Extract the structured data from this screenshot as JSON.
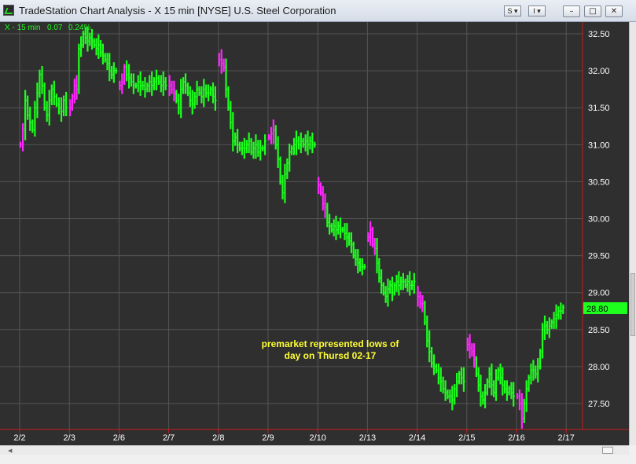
{
  "window": {
    "title": "TradeStation Chart Analysis - X 15 min [NYSE] U.S. Steel Corporation",
    "btn_s": "S",
    "btn_i": "I",
    "minimize_glyph": "–",
    "maximize_glyph": "□",
    "close_glyph": "✕"
  },
  "chart_data": {
    "type": "line",
    "title": "",
    "symbol_label": "X - 15 min",
    "change": "0.07",
    "change_pct": "0.24%",
    "last_price": "28.80",
    "xlabel": "",
    "ylabel": "",
    "ylim": [
      27.2,
      32.58
    ],
    "y_ticks": [
      "32.50",
      "32.00",
      "31.50",
      "31.00",
      "30.50",
      "30.00",
      "29.50",
      "29.00",
      "28.50",
      "28.00",
      "27.50"
    ],
    "x_ticks": [
      "2/2",
      "2/3",
      "2/6",
      "2/7",
      "2/8",
      "2/9",
      "2/10",
      "2/13",
      "2/14",
      "2/15",
      "2/16",
      "2/17"
    ],
    "grid": true,
    "annotation": [
      "premarket represented lows of",
      "day on Thursd 02-17"
    ],
    "colors": {
      "up": "#1eff1e",
      "premarket": "#ff28ff",
      "background": "#2f2f2f",
      "grid": "#555555",
      "axis": "#c81e1e",
      "annotation": "#ffff33",
      "tick_text": "#ffffff",
      "last_price_bg": "#1eff1e"
    },
    "series": [
      {
        "name": "X - 15 min",
        "days": [
          {
            "date": "2/2",
            "pre": [
              31.0,
              31.2
            ],
            "regular": [
              31.6,
              31.4,
              31.3,
              31.2,
              31.5,
              31.7,
              31.95,
              31.8,
              31.5,
              31.4,
              31.6,
              31.75,
              31.65,
              31.55,
              31.5,
              31.45,
              31.6,
              31.5
            ]
          },
          {
            "date": "2/3",
            "pre": [
              31.5,
              31.65,
              31.8,
              31.75
            ],
            "regular": [
              32.3,
              32.35,
              32.5,
              32.45,
              32.4,
              32.45,
              32.4,
              32.35,
              32.3,
              32.35,
              32.25,
              32.2,
              32.15,
              32.1,
              32.0,
              31.95,
              32.0,
              32.0
            ]
          },
          {
            "date": "2/6",
            "pre": [
              31.8,
              31.85,
              32.05
            ],
            "regular": [
              31.95,
              31.9,
              31.85,
              31.8,
              31.8,
              31.85,
              31.8,
              31.8,
              31.75,
              31.8,
              31.85,
              31.8,
              31.85,
              31.9,
              31.85,
              31.8,
              31.85,
              31.8
            ]
          },
          {
            "date": "2/7",
            "pre": [
              31.8,
              31.75,
              31.7
            ],
            "regular": [
              31.6,
              31.5,
              31.75,
              31.85,
              31.8,
              31.7,
              31.6,
              31.55,
              31.65,
              31.75,
              31.7,
              31.65,
              31.75,
              31.7,
              31.7,
              31.75,
              31.65,
              31.6
            ]
          },
          {
            "date": "2/8",
            "pre": [
              32.15,
              32.1,
              32.05
            ],
            "regular": [
              31.75,
              31.5,
              31.3,
              31.05,
              31.1,
              31.0,
              30.95,
              30.95,
              30.95,
              31.0,
              31.05,
              30.9,
              30.95,
              31.0,
              30.9,
              30.95,
              30.95,
              31.05
            ]
          },
          {
            "date": "2/9",
            "pre": [
              31.1,
              31.15,
              31.2
            ],
            "regular": [
              31.0,
              30.8,
              30.5,
              30.35,
              30.6,
              30.75,
              30.9,
              30.95,
              31.0,
              31.05,
              31.0,
              31.05,
              31.0,
              31.05,
              31.0,
              31.05,
              31.0,
              31.0
            ]
          },
          {
            "date": "2/10",
            "pre": [
              30.45,
              30.35,
              30.2,
              30.15
            ],
            "regular": [
              29.95,
              29.9,
              29.85,
              29.9,
              29.85,
              29.9,
              29.85,
              29.85,
              29.8,
              29.75,
              29.7,
              29.65,
              29.5,
              29.45,
              29.4,
              29.35,
              29.35,
              29.35
            ]
          },
          {
            "date": "2/13",
            "pre": [
              29.75,
              29.85,
              29.65,
              29.6
            ],
            "regular": [
              29.4,
              29.2,
              29.1,
              29.0,
              28.95,
              29.05,
              29.1,
              29.0,
              29.1,
              29.15,
              29.1,
              29.15,
              29.15,
              29.1,
              29.15,
              29.1,
              29.1,
              29.15
            ]
          },
          {
            "date": "2/14",
            "pre": [
              28.95,
              28.85,
              28.85
            ],
            "regular": [
              28.6,
              28.35,
              28.2,
              28.05,
              28.0,
              27.95,
              27.85,
              27.8,
              27.7,
              27.65,
              27.6,
              27.6,
              27.55,
              27.7,
              27.8,
              27.9,
              27.85,
              27.8
            ]
          },
          {
            "date": "2/15",
            "pre": [
              28.3,
              28.25,
              28.2,
              28.1
            ],
            "regular": [
              27.9,
              27.75,
              27.6,
              27.55,
              27.65,
              27.8,
              27.9,
              27.75,
              27.65,
              27.85,
              27.95,
              27.85,
              27.75,
              27.7,
              27.65,
              27.7,
              27.65,
              27.6
            ]
          },
          {
            "date": "2/16",
            "pre": [
              27.6,
              27.5,
              27.3
            ],
            "regular": [
              27.5,
              27.7,
              27.85,
              27.95,
              27.95,
              27.9,
              28.0,
              28.2,
              28.5,
              28.55,
              28.5,
              28.55,
              28.6,
              28.65,
              28.7,
              28.75,
              28.75,
              28.8
            ]
          }
        ]
      }
    ]
  }
}
